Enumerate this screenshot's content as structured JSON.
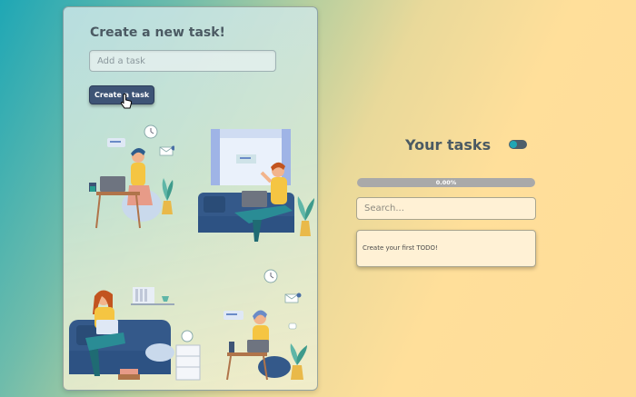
{
  "create_panel": {
    "title": "Create a new task!",
    "input_placeholder": "Add a task",
    "button_label": "Create a task"
  },
  "tasks_panel": {
    "title": "Your tasks",
    "progress_label": "0.00%",
    "progress_fraction": 0.0,
    "search_placeholder": "Search...",
    "empty_message": "Create your first TODO!"
  },
  "colors": {
    "accent": "#1fa7b5",
    "button": "#3e5476",
    "progress_track": "#a9a9a9",
    "card_bg": "#fff1d5"
  },
  "icons": [
    "pointer-cursor-icon",
    "toggle-icon"
  ]
}
